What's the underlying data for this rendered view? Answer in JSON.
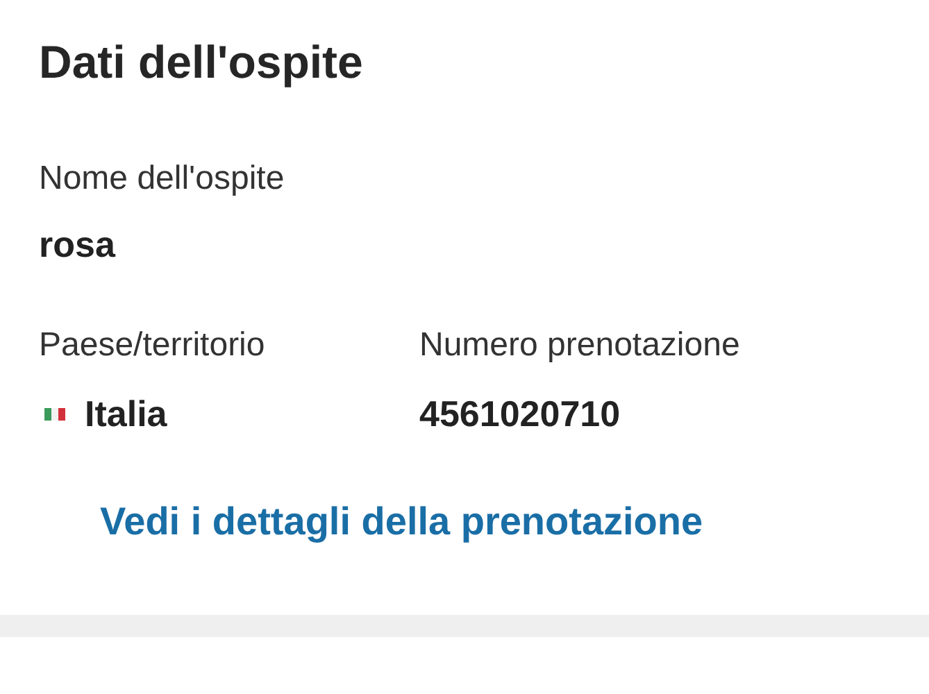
{
  "title": "Dati dell'ospite",
  "guest": {
    "label": "Nome dell'ospite",
    "value": "rosa"
  },
  "fields": [
    {
      "label": "Paese/territorio",
      "value": "Italia",
      "kind": "country"
    },
    {
      "label": "Numero prenotazione",
      "value": "4561020710",
      "kind": "text"
    }
  ],
  "link": "Vedi i dettagli della prenotazione"
}
